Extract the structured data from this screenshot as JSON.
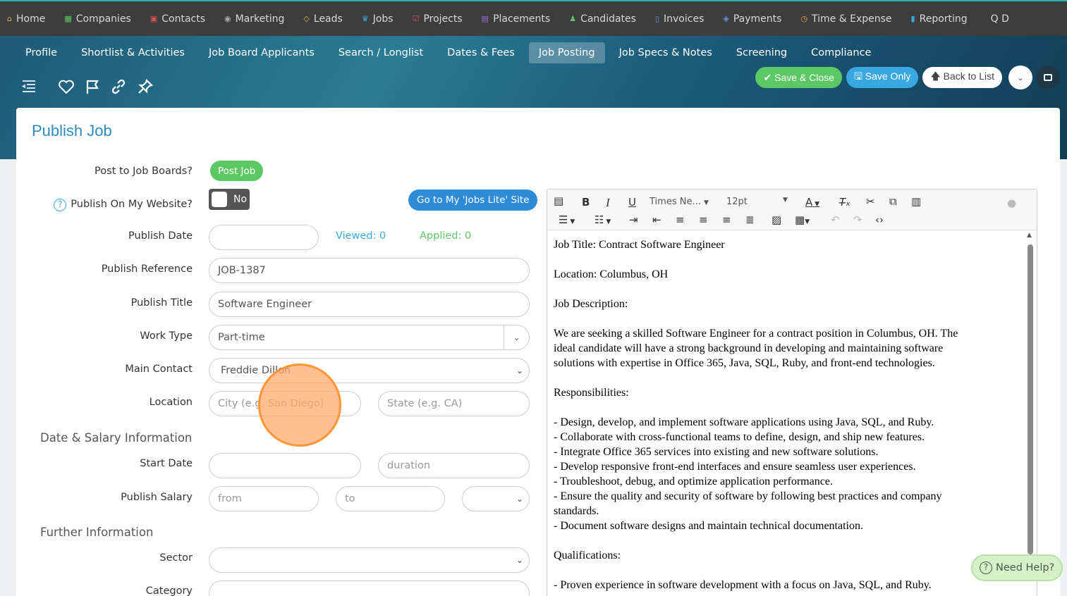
{
  "top_nav": [
    {
      "label": "Home",
      "icon": "home-icon",
      "color": "#e3b84e",
      "glyph": "⌂"
    },
    {
      "label": "Companies",
      "icon": "building-icon",
      "color": "#5cc864",
      "glyph": "▦"
    },
    {
      "label": "Contacts",
      "icon": "contact-card-icon",
      "color": "#e05252",
      "glyph": "▣"
    },
    {
      "label": "Marketing",
      "icon": "broadcast-icon",
      "color": "#aaaaaa",
      "glyph": "◉"
    },
    {
      "label": "Leads",
      "icon": "diamond-icon",
      "color": "#e3b84e",
      "glyph": "◇"
    },
    {
      "label": "Jobs",
      "icon": "trophy-icon",
      "color": "#3aa8e0",
      "glyph": "♛"
    },
    {
      "label": "Projects",
      "icon": "checkbox-icon",
      "color": "#e05252",
      "glyph": "☑"
    },
    {
      "label": "Placements",
      "icon": "briefcase-icon",
      "color": "#a070d0",
      "glyph": "▤"
    },
    {
      "label": "Candidates",
      "icon": "person-icon",
      "color": "#5cc864",
      "glyph": "♟"
    },
    {
      "label": "Invoices",
      "icon": "document-icon",
      "color": "#6a8fe0",
      "glyph": "▯"
    },
    {
      "label": "Payments",
      "icon": "payment-icon",
      "color": "#6a8fe0",
      "glyph": "◈"
    },
    {
      "label": "Time & Expense",
      "icon": "clock-icon",
      "color": "#e3a04e",
      "glyph": "◷"
    },
    {
      "label": "Reporting",
      "icon": "bar-chart-icon",
      "color": "#3aa8e0",
      "glyph": "▮"
    },
    {
      "label": "Q D",
      "icon": "search-icon",
      "color": "#ffffff",
      "glyph": ""
    }
  ],
  "sub_tabs": [
    "Profile",
    "Shortlist & Activities",
    "Job Board Applicants",
    "Search / Longlist",
    "Dates & Fees",
    "Job Posting",
    "Job Specs & Notes",
    "Screening",
    "Compliance"
  ],
  "actions": {
    "save_close": "✔ Save & Close",
    "save_only": "🖫 Save Only",
    "back": "🡅 Back to List"
  },
  "page_title": "Publish Job",
  "form": {
    "post_label": "Post to Job Boards?",
    "post_button": "Post Job",
    "website_label": "Publish On My Website?",
    "toggle_value": "No",
    "jobs_lite_button": "Go to My 'Jobs Lite' Site",
    "publish_date_label": "Publish Date",
    "viewed": "Viewed: 0",
    "applied": "Applied: 0",
    "reference_label": "Publish Reference",
    "reference_value": "JOB-1387",
    "title_label": "Publish Title",
    "title_value": "Software Engineer",
    "worktype_label": "Work Type",
    "worktype_value": "Part-time",
    "contact_label": "Main Contact",
    "contact_value": "Freddie Dillon",
    "location_label": "Location",
    "city_placeholder": "City (e.g. San Diego)",
    "state_placeholder": "State (e.g. CA)",
    "section_salary": "Date & Salary Information",
    "start_label": "Start Date",
    "duration_placeholder": "duration",
    "salary_label": "Publish Salary",
    "from_placeholder": "from",
    "to_placeholder": "to",
    "section_further": "Further Information",
    "sector_label": "Sector",
    "category_label": "Category"
  },
  "editor": {
    "font_name": "Times Ne...",
    "font_size": "12pt",
    "paragraphs": [
      [
        "Job Title: Contract Software Engineer"
      ],
      [
        "Location: Columbus, OH"
      ],
      [
        "Job Description:"
      ],
      [
        "We are seeking a skilled Software Engineer for a contract position in Columbus, OH. The",
        "ideal candidate will have a strong background in developing and maintaining software",
        "solutions with expertise in Office 365, Java, SQL, Ruby, and front-end technologies."
      ],
      [
        "Responsibilities:"
      ],
      [
        "- Design, develop, and implement software applications using Java, SQL, and Ruby.",
        "- Collaborate with cross-functional teams to define, design, and ship new features.",
        "- Integrate Office 365 services into existing and new software solutions.",
        "- Develop responsive front-end interfaces and ensure seamless user experiences.",
        "- Troubleshoot, debug, and optimize application performance.",
        "- Ensure the quality and security of software by following best practices and company",
        "standards.",
        "- Document software designs and maintain technical documentation."
      ],
      [
        "Qualifications:"
      ],
      [
        "- Proven experience in software development with a focus on Java, SQL, and Ruby."
      ]
    ]
  },
  "help_button": "Need Help?"
}
